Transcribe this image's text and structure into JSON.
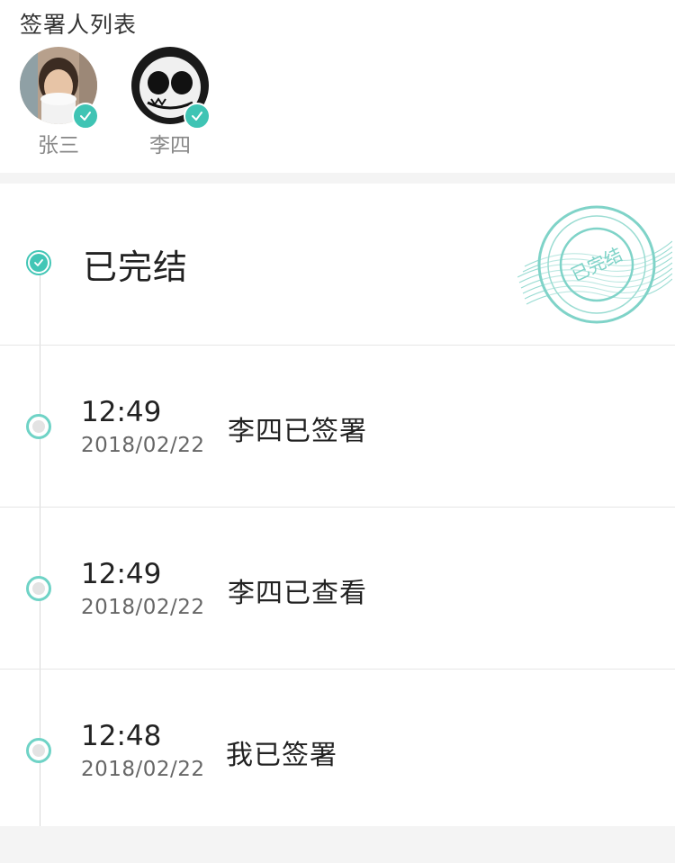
{
  "signers_section": {
    "title": "签署人列表",
    "signers": [
      {
        "name": "张三",
        "signed": true
      },
      {
        "name": "李四",
        "signed": true
      }
    ]
  },
  "status": {
    "title": "已完结",
    "stamp_text": "已完结"
  },
  "events": [
    {
      "time": "12:49",
      "date": "2018/02/22",
      "text": "李四已签署"
    },
    {
      "time": "12:49",
      "date": "2018/02/22",
      "text": "李四已查看"
    },
    {
      "time": "12:48",
      "date": "2018/02/22",
      "text": "我已签署"
    }
  ],
  "colors": {
    "accent": "#42c6b6",
    "background": "#f4f4f4",
    "text_primary": "#222222",
    "text_secondary": "#666666"
  },
  "icons": {
    "signed_badge": "check-icon",
    "status_done": "check-circle-icon",
    "event_pending": "hollow-circle-icon"
  }
}
